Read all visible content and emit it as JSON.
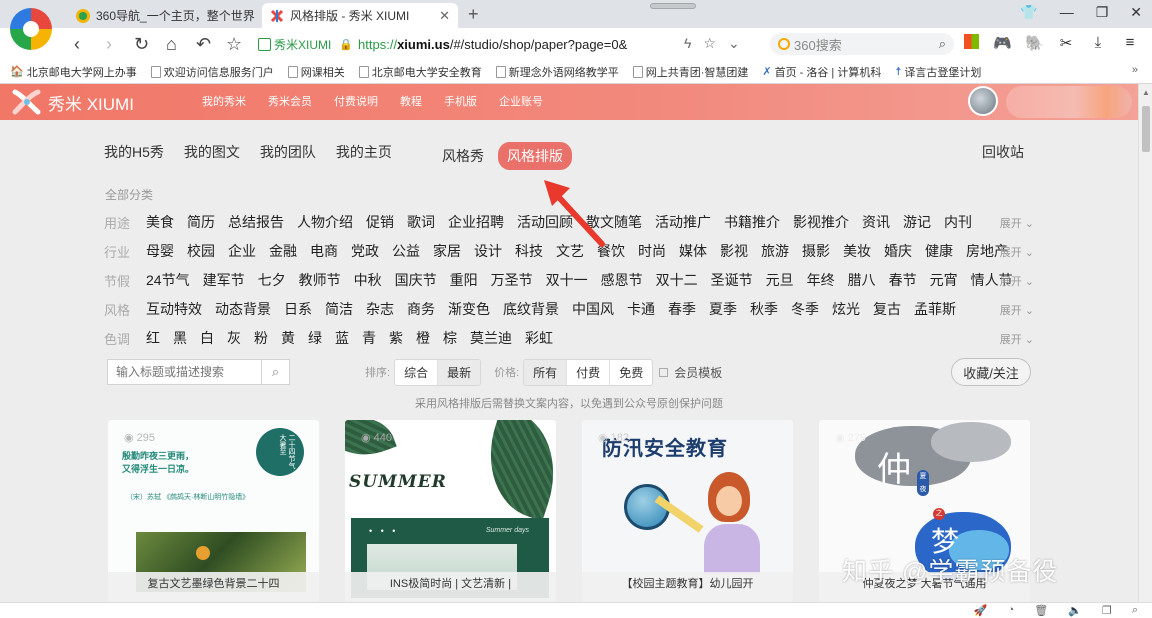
{
  "browser": {
    "tabs": [
      {
        "title": "360导航_一个主页，整个世界",
        "active": false
      },
      {
        "title": "风格排版 - 秀米 XIUMI",
        "active": true
      }
    ],
    "new_tab": "+",
    "url_badge": "秀米XIUMI",
    "url_scheme": "https://",
    "url_domain": "xiumi.us",
    "url_path": "/#/studio/shop/paper?page=0&",
    "search_placeholder": "360搜索",
    "bookmarks": [
      "北京邮电大学网上办事",
      "欢迎访问信息服务门户",
      "网课相关",
      "北京邮电大学安全教育",
      "新理念外语网络教学平",
      "网上共青团·智慧团建",
      "首页 - 洛谷 | 计算机科",
      "译言古登堡计划"
    ]
  },
  "site": {
    "logo_text": "秀米 XIUMI",
    "nav_links": [
      "我的秀米",
      "秀米会员",
      "付费说明",
      "教程",
      "手机版",
      "企业账号"
    ]
  },
  "studio": {
    "left_tabs": [
      "我的H5秀",
      "我的图文",
      "我的团队",
      "我的主页"
    ],
    "mid_tabs": [
      "风格秀",
      "风格排版"
    ],
    "active_tab": "风格排版",
    "recycle": "回收站",
    "all_categories": "全部分类",
    "expand_label": "展开",
    "categories": [
      {
        "label": "用途",
        "items": [
          "美食",
          "简历",
          "总结报告",
          "人物介绍",
          "促销",
          "歌词",
          "企业招聘",
          "活动回顾",
          "散文随笔",
          "活动推广",
          "书籍推介",
          "影视推介",
          "资讯",
          "游记",
          "内刊"
        ]
      },
      {
        "label": "行业",
        "items": [
          "母婴",
          "校园",
          "企业",
          "金融",
          "电商",
          "党政",
          "公益",
          "家居",
          "设计",
          "科技",
          "文艺",
          "餐饮",
          "时尚",
          "媒体",
          "影视",
          "旅游",
          "摄影",
          "美妆",
          "婚庆",
          "健康",
          "房地产"
        ]
      },
      {
        "label": "节假",
        "items": [
          "24节气",
          "建军节",
          "七夕",
          "教师节",
          "中秋",
          "国庆节",
          "重阳",
          "万圣节",
          "双十一",
          "感恩节",
          "双十二",
          "圣诞节",
          "元旦",
          "年终",
          "腊八",
          "春节",
          "元宵",
          "情人节"
        ]
      },
      {
        "label": "风格",
        "items": [
          "互动特效",
          "动态背景",
          "日系",
          "简洁",
          "杂志",
          "商务",
          "渐变色",
          "底纹背景",
          "中国风",
          "卡通",
          "春季",
          "夏季",
          "秋季",
          "冬季",
          "炫光",
          "复古",
          "孟菲斯"
        ]
      },
      {
        "label": "色调",
        "items": [
          "红",
          "黑",
          "白",
          "灰",
          "粉",
          "黄",
          "绿",
          "蓝",
          "青",
          "紫",
          "橙",
          "棕",
          "莫兰迪",
          "彩虹"
        ]
      }
    ],
    "search_placeholder": "输入标题或描述搜索",
    "sort_label": "排序:",
    "sort_options": [
      "综合",
      "最新"
    ],
    "sort_selected": "最新",
    "price_label": "价格:",
    "price_options": [
      "所有",
      "付费",
      "免费"
    ],
    "price_selected": "所有",
    "member_template": "会员模板",
    "favorite_button": "收藏/关注",
    "notice": "采用风格排版后需替换文案内容，以免遇到公众号原创保护问题"
  },
  "cards": [
    {
      "views": "295",
      "caption": "复古文艺墨绿色背景二十四",
      "poem_line1": "殷勤昨夜三更雨，",
      "poem_line2": "又得浮生一日凉。",
      "poem_source": "（宋）苏轼 《鹧鸪天·林断山明竹隐墙》",
      "circle_text": "二十四节气 大暑至"
    },
    {
      "views": "440",
      "caption": "INS极简时尚 | 文艺清新 |",
      "art_title": "SUMMER",
      "art_sub": "Summer days",
      "art_dots": "• • •"
    },
    {
      "views": "182",
      "caption": "【校园主题教育】幼儿园开",
      "art_title": "防汛安全教育"
    },
    {
      "views": "279",
      "caption": "仲夏夜之梦 大暑节气通用",
      "art_char": "仲",
      "art_pill": "夏夜",
      "art_dot": "之",
      "art_char2": "梦"
    }
  ],
  "watermark": "知乎 @学霸预备役",
  "colors": {
    "brand": "#ef6f63",
    "active_pill": "#e9716a",
    "arrow": "#e8392c"
  }
}
